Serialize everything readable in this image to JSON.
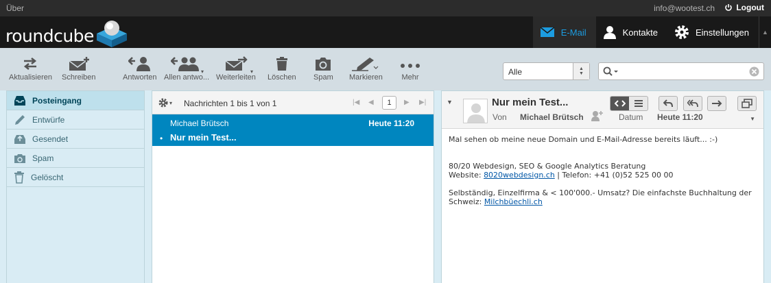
{
  "topline": {
    "about": "Über",
    "user": "info@wootest.ch",
    "logout": "Logout"
  },
  "header": {
    "logo": "roundcube",
    "nav": [
      {
        "label": "E-Mail",
        "icon": "mail-icon",
        "active": true
      },
      {
        "label": "Kontakte",
        "icon": "person-icon"
      },
      {
        "label": "Einstellungen",
        "icon": "gear-icon"
      }
    ]
  },
  "toolbar": {
    "refresh": "Aktualisieren",
    "compose": "Schreiben",
    "reply": "Antworten",
    "reply_all": "Allen antwo...",
    "forward": "Weiterleiten",
    "delete": "Löschen",
    "spam": "Spam",
    "mark": "Markieren",
    "more": "Mehr"
  },
  "filter": {
    "value": "Alle"
  },
  "search": {
    "placeholder": ""
  },
  "folders": [
    {
      "label": "Posteingang",
      "icon": "inbox-icon"
    },
    {
      "label": "Entwürfe",
      "icon": "pencil-icon"
    },
    {
      "label": "Gesendet",
      "icon": "sent-icon"
    },
    {
      "label": "Spam",
      "icon": "spam-icon"
    },
    {
      "label": "Gelöscht",
      "icon": "trash-icon"
    }
  ],
  "messagelist": {
    "count": "Nachrichten 1 bis 1 von 1",
    "page": "1",
    "messages": [
      {
        "from": "Michael Brütsch",
        "date": "Heute 11:20",
        "subject": "Nur mein Test..."
      }
    ]
  },
  "preview": {
    "subject": "Nur mein Test...",
    "from_label": "Von",
    "from": "Michael Brütsch",
    "date_label": "Datum",
    "date": "Heute 11:20",
    "body": {
      "line1": "Mal sehen ob meine neue Domain und E-Mail-Adresse bereits läuft... :-)",
      "sig1": "80/20 Webdesign, SEO & Google Analytics Beratung",
      "sig2_pre": "Website: ",
      "sig2_link": "8020webdesign.ch",
      "sig2_post": " | Telefon: +41 (0)52 525 00 00",
      "sig3": "Selbständig, Einzelfirma & < 100'000.- Umsatz? Die einfachste Buchhaltung der",
      "sig4_pre": "Schweiz: ",
      "sig4_link": "Milchbüechli.ch"
    }
  },
  "colors": {
    "accent": "#0086bf",
    "nav_active": "#1c9ce0",
    "header": "#191919"
  }
}
